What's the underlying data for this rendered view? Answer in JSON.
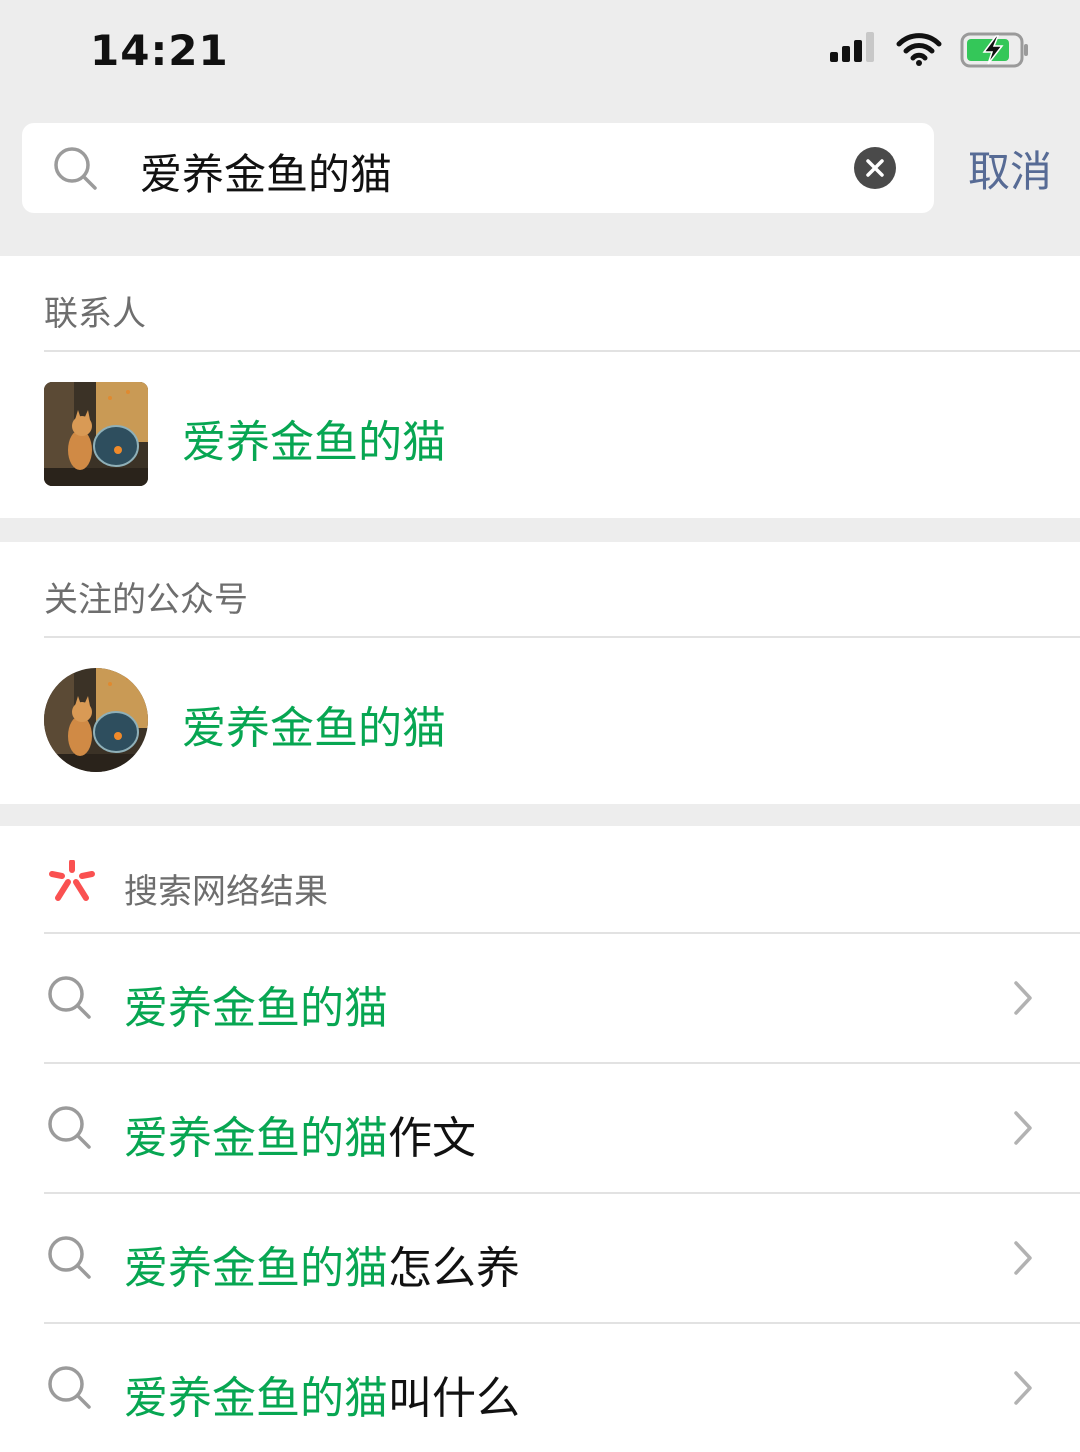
{
  "status_bar": {
    "time": "14:21"
  },
  "search": {
    "query": "爱养金鱼的猫",
    "cancel_label": "取消"
  },
  "contacts_section": {
    "header": "联系人",
    "items": [
      {
        "name": "爱养金鱼的猫"
      }
    ]
  },
  "accounts_section": {
    "header": "关注的公众号",
    "items": [
      {
        "name": "爱养金鱼的猫"
      }
    ]
  },
  "web_section": {
    "header": "搜索网络结果",
    "suggestions": [
      {
        "highlight": "爱养金鱼的猫",
        "rest": ""
      },
      {
        "highlight": "爱养金鱼的猫",
        "rest": "作文"
      },
      {
        "highlight": "爱养金鱼的猫",
        "rest": "怎么养"
      },
      {
        "highlight": "爱养金鱼的猫",
        "rest": "叫什么"
      }
    ]
  },
  "colors": {
    "highlight_green": "#07a652",
    "link_blue": "#576b95",
    "sou_icon_red": "#fa5151"
  },
  "icons": [
    "signal-icon",
    "wifi-icon",
    "battery-charging-icon",
    "search-icon",
    "clear-icon",
    "sou-icon",
    "chevron-right-icon"
  ]
}
